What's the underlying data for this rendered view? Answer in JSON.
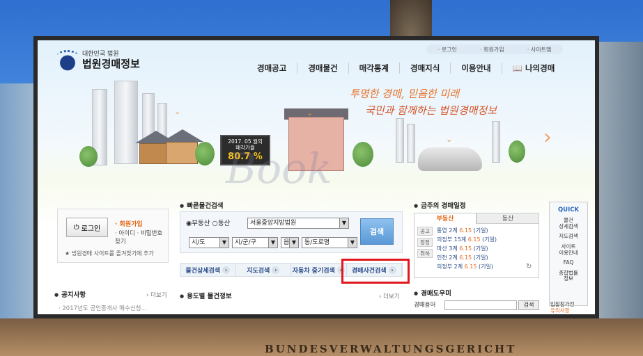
{
  "background": {
    "caption": "BUNDESVERWALTUNGSGERICHT"
  },
  "site": {
    "logo_sub": "대한민국 법원",
    "logo_main": "법원경매정보",
    "util": [
      "· 로그인",
      "· 회원가입",
      "· 사이트맵"
    ],
    "gnb": [
      "경매공고",
      "경매물건",
      "매각통계",
      "경매지식",
      "이용안내",
      "📖 나의경매"
    ]
  },
  "hero": {
    "slogan1": "투명한 경매, 믿음한 미래",
    "slogan2": "국민과 함께하는 법원경매정보",
    "billboard_line1": "2017. 05 월의",
    "billboard_line2": "매각가율",
    "billboard_pct": "80.7 %",
    "watermark": "Book"
  },
  "login": {
    "button": "로그인",
    "join": "· 회원가입",
    "idpw": "· 아이디 · 비밀번호찾기",
    "favorite": "법원경매 사이트를 즐겨찾기에 추가"
  },
  "notice": {
    "title": "공지사항",
    "more": "› 더보기",
    "item": "· 2017년도 공인중개사 매수신청..."
  },
  "quick_search": {
    "title": "빠른물건검색",
    "radio": "◉부동산 ○동산",
    "court": "서울중앙지방법원",
    "sido": "시/도",
    "sigungu": "시/군/구",
    "eup": "읍",
    "dong": "동/도로명",
    "button": "검색",
    "tabs": [
      "물건상세검색",
      "지도검색",
      "자동차 중기검색",
      "경매사건검색"
    ]
  },
  "usage": {
    "title": "용도별 물건정보",
    "more": "› 더보기"
  },
  "schedule": {
    "title": "금주의 경매일정",
    "tab_on": "부동산",
    "tab_off": "동산",
    "side": [
      "공고",
      "정정",
      "취하"
    ],
    "rows": [
      {
        "place": "통영 2계",
        "date": "6.15",
        "note": "(기일)"
      },
      {
        "place": "의정부 15계",
        "date": "6.15",
        "note": "(기일)"
      },
      {
        "place": "마산 3계",
        "date": "6.15",
        "note": "(기일)"
      },
      {
        "place": "인천 2계",
        "date": "6.15",
        "note": "(기일)"
      },
      {
        "place": "의정부 2계",
        "date": "6.15",
        "note": "(기일)"
      }
    ]
  },
  "helper": {
    "title": "경매도우미",
    "label": "경매용어",
    "button": "검색"
  },
  "quick_menu": {
    "title": "QUICK",
    "items": [
      "물건\n상세검색",
      "지도검색",
      "사이트\n이용안내",
      "FAQ",
      "종합법률\n정보"
    ]
  },
  "entry": {
    "line1": "입찰참가전",
    "line2": "유의사항"
  }
}
